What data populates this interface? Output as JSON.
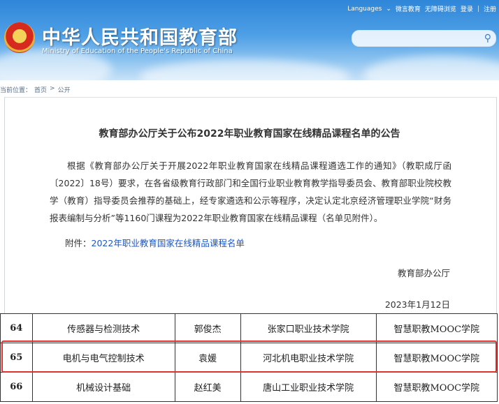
{
  "header": {
    "title_cn": "中华人民共和国教育部",
    "title_en": "Ministry of Education of the People's Republic of China",
    "links": [
      "Languages",
      "微言教育",
      "无障碍浏览",
      "登录",
      "注册"
    ],
    "search_placeholder": ""
  },
  "breadcrumb": {
    "prefix": "当前位置：",
    "home": "首页",
    "sep": ">",
    "current": "公开"
  },
  "article": {
    "title": "教育部办公厅关于公布2022年职业教育国家在线精品课程名单的公告",
    "body": "根据《教育部办公厅关于开展2022年职业教育国家在线精品课程遴选工作的通知》（教职成厅函〔2022〕18号）要求，在各省级教育行政部门和全国行业职业教育教学指导委员会、教育部职业院校教学（教育）指导委员会推荐的基础上，经专家遴选和公示等程序，决定认定北京经济管理职业学院“财务报表编制与分析”等1160门课程为2022年职业教育国家在线精品课程（名单见附件）。",
    "attachment_label": "附件：",
    "attachment_link": "2022年职业教育国家在线精品课程名单",
    "signature": "教育部办公厅",
    "date": "2023年1月12日"
  },
  "table": {
    "rows": [
      {
        "no": "64",
        "course": "传感器与检测技术",
        "person": "郭俊杰",
        "school": "张家口职业技术学院",
        "platform": "智慧职教MOOC学院"
      },
      {
        "no": "65",
        "course": "电机与电气控制技术",
        "person": "袁媛",
        "school": "河北机电职业技术学院",
        "platform": "智慧职教MOOC学院"
      },
      {
        "no": "66",
        "course": "机械设计基础",
        "person": "赵红美",
        "school": "唐山工业职业技术学院",
        "platform": "智慧职教MOOC学院"
      }
    ]
  },
  "colors": {
    "highlight": "#e0312f",
    "link": "#1a56c8"
  }
}
